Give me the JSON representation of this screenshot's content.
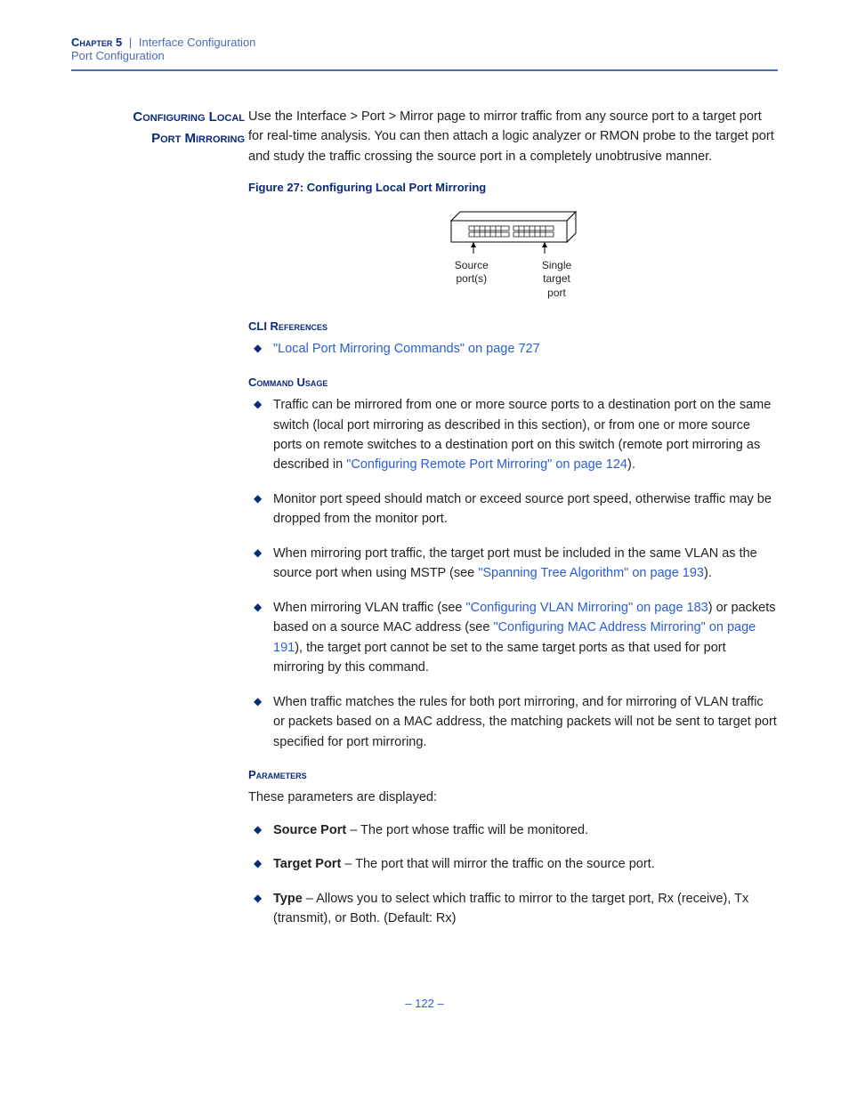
{
  "header": {
    "chapter": "Chapter 5",
    "separator": "|",
    "section": "Interface Configuration",
    "subsection": "Port Configuration"
  },
  "marginTitle": {
    "line1": "Configuring Local",
    "line2": "Port Mirroring"
  },
  "intro": "Use the Interface > Port > Mirror page to mirror traffic from any source port to a target port for real-time analysis. You can then attach a logic analyzer or RMON probe to the target port and study the traffic crossing the source port in a completely unobtrusive manner.",
  "figure": {
    "caption": "Figure 27:  Configuring Local Port Mirroring",
    "labelLeft1": "Source",
    "labelLeft2": "port(s)",
    "labelRight1": "Single",
    "labelRight2": "target",
    "labelRight3": "port"
  },
  "cliRef": {
    "heading": "CLI References",
    "link": "\"Local Port Mirroring Commands\" on page 727"
  },
  "commandUsage": {
    "heading": "Command Usage",
    "items": [
      {
        "pre": "Traffic can be mirrored from one or more source ports to a destination port on the same switch (local port mirroring as described in this section), or from one or more source ports on remote switches to a destination port on this switch (remote port mirroring as described in ",
        "link": "\"Configuring Remote Port Mirroring\" on page 124",
        "post": ")."
      },
      {
        "pre": "Monitor port speed should match or exceed source port speed, otherwise traffic may be dropped from the monitor port.",
        "link": "",
        "post": ""
      },
      {
        "pre": "When mirroring port traffic, the target port must be included in the same VLAN as the source port when using MSTP (see ",
        "link": "\"Spanning Tree Algorithm\" on page 193",
        "post": ")."
      },
      {
        "pre": "When mirroring VLAN traffic (see ",
        "link": "\"Configuring VLAN Mirroring\" on page 183",
        "mid": ") or packets based on a source MAC address (see ",
        "link2": "\"Configuring MAC Address Mirroring\" on page 191",
        "post": "), the target port cannot be set to the same target ports as that used for port mirroring by this command."
      },
      {
        "pre": "When traffic matches the rules for both port mirroring, and for mirroring of VLAN traffic or packets based on a MAC address, the matching packets will not be sent to target port specified for port mirroring.",
        "link": "",
        "post": ""
      }
    ]
  },
  "parameters": {
    "heading": "Parameters",
    "intro": "These parameters are displayed:",
    "items": [
      {
        "term": "Source Port",
        "desc": " – The port whose traffic will be monitored."
      },
      {
        "term": "Target Port",
        "desc": " – The port that will mirror the traffic on the source port."
      },
      {
        "term": "Type",
        "desc": " – Allows you to select which traffic to mirror to the target port, Rx (receive), Tx (transmit), or Both. (Default: Rx)"
      }
    ]
  },
  "pageNumber": "–  122  –"
}
